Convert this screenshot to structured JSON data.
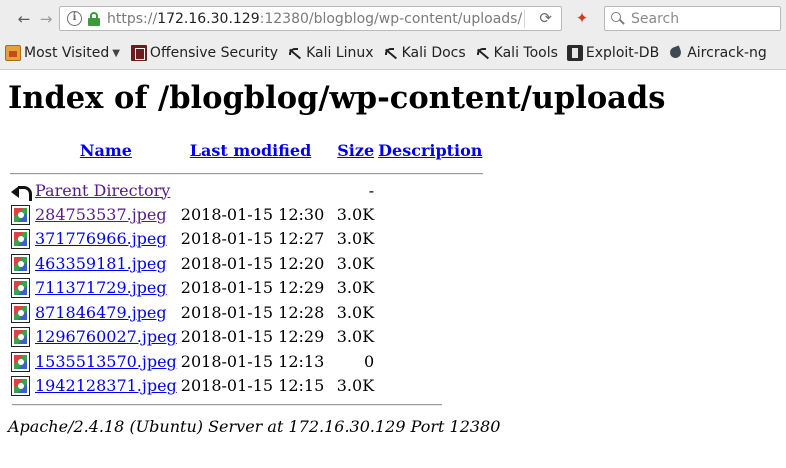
{
  "browser": {
    "url_scheme": "https://",
    "url_host": "172.16.30.129",
    "url_rest": ":12380/blogblog/wp-content/uploads/",
    "search_placeholder": "Search",
    "back_glyph": "←",
    "forward_glyph": "→",
    "reload_glyph": "⟳",
    "extension_glyph": "✦",
    "info_glyph": "i"
  },
  "bookmarks": [
    {
      "label": "Most Visited",
      "icon": "folder-icon",
      "has_dropdown": true
    },
    {
      "label": "Offensive Security",
      "icon": "offensive-security-icon"
    },
    {
      "label": "Kali Linux",
      "icon": "kali-dragon-icon"
    },
    {
      "label": "Kali Docs",
      "icon": "kali-dragon-icon"
    },
    {
      "label": "Kali Tools",
      "icon": "kali-dragon-icon"
    },
    {
      "label": "Exploit-DB",
      "icon": "exploit-db-icon"
    },
    {
      "label": "Aircrack-ng",
      "icon": "aircrack-icon"
    }
  ],
  "page": {
    "title": "Index of /blogblog/wp-content/uploads",
    "columns": {
      "name": "Name",
      "last_modified": "Last modified",
      "size": "Size",
      "description": "Description"
    },
    "parent": {
      "name": "Parent Directory",
      "size": "-"
    },
    "files": [
      {
        "name": "284753537.jpeg",
        "modified": "2018-01-15 12:30",
        "size": "3.0K",
        "visited": true
      },
      {
        "name": "371776966.jpeg",
        "modified": "2018-01-15 12:27",
        "size": "3.0K",
        "visited": false
      },
      {
        "name": "463359181.jpeg",
        "modified": "2018-01-15 12:20",
        "size": "3.0K",
        "visited": false
      },
      {
        "name": "711371729.jpeg",
        "modified": "2018-01-15 12:29",
        "size": "3.0K",
        "visited": false
      },
      {
        "name": "871846479.jpeg",
        "modified": "2018-01-15 12:28",
        "size": "3.0K",
        "visited": false
      },
      {
        "name": "1296760027.jpeg",
        "modified": "2018-01-15 12:29",
        "size": "3.0K",
        "visited": false
      },
      {
        "name": "1535513570.jpeg",
        "modified": "2018-01-15 12:13",
        "size": "0",
        "visited": false
      },
      {
        "name": "1942128371.jpeg",
        "modified": "2018-01-15 12:15",
        "size": "3.0K",
        "visited": false
      }
    ],
    "footer": "Apache/2.4.18 (Ubuntu) Server at 172.16.30.129 Port 12380"
  }
}
